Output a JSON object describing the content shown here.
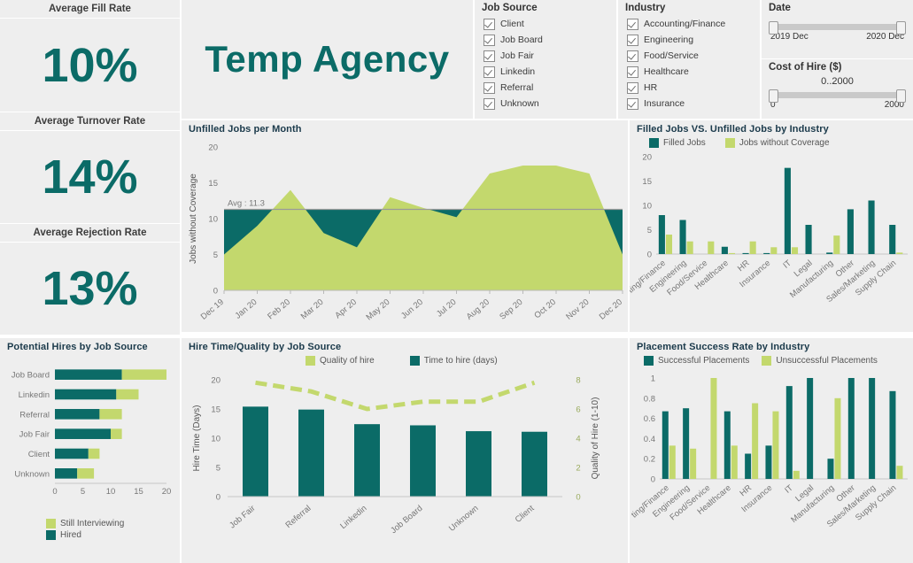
{
  "title": "Temp Agency",
  "kpis": [
    {
      "label": "Average Fill Rate",
      "value": "10%"
    },
    {
      "label": "Average Turnover Rate",
      "value": "14%"
    },
    {
      "label": "Average Rejection Rate",
      "value": "13%"
    }
  ],
  "filters": {
    "job_source": {
      "title": "Job Source",
      "items": [
        "Client",
        "Job Board",
        "Job Fair",
        "Linkedin",
        "Referral",
        "Unknown"
      ],
      "checked": true
    },
    "industry": {
      "title": "Industry",
      "items": [
        "Accounting/Finance",
        "Engineering",
        "Food/Service",
        "Healthcare",
        "HR",
        "Insurance"
      ],
      "checked": true
    },
    "date": {
      "title": "Date",
      "min_label": "2019 Dec",
      "max_label": "2020 Dec"
    },
    "cost": {
      "title": "Cost of Hire ($)",
      "range_label": "0..2000",
      "min_label": "0",
      "max_label": "2000"
    }
  },
  "colors": {
    "teal": "#0b6b67",
    "green": "#c3d86d",
    "panel": "#eeeeee",
    "page": "#ffffff",
    "title": "#0b6b67"
  },
  "chart_data": [
    {
      "id": "unfilled-jobs-per-month",
      "type": "area",
      "title": "Unfilled Jobs per Month",
      "xlabel": "",
      "ylabel": "Jobs without Coverage",
      "ylim": [
        0,
        20
      ],
      "yticks": [
        0,
        5,
        10,
        15,
        20
      ],
      "grid": false,
      "annotation": "Avg : 11.3",
      "average": 11.3,
      "categories": [
        "Dec 19",
        "Jan 20",
        "Feb 20",
        "Mar 20",
        "Apr 20",
        "May 20",
        "Jun 20",
        "Jul 20",
        "Aug 20",
        "Sep 20",
        "Oct 20",
        "Nov 20",
        "Dec 20"
      ],
      "values": [
        5,
        9,
        14,
        8,
        6,
        13,
        11.5,
        10.2,
        16.3,
        17.4,
        17.4,
        16.3,
        5
      ],
      "series": [
        {
          "name": "Jobs without Coverage",
          "values": [
            5,
            9,
            14,
            8,
            6,
            13,
            11.5,
            10.2,
            16.3,
            17.4,
            17.4,
            16.3,
            5
          ],
          "color": "#c3d86d"
        }
      ],
      "background_band_color": "#0b6b67"
    },
    {
      "id": "filled-vs-unfilled-by-industry",
      "type": "bar",
      "title": "Filled Jobs VS. Unfilled Jobs by Industry",
      "xlabel": "",
      "ylabel": "",
      "ylim": [
        0,
        20
      ],
      "yticks": [
        0,
        5,
        10,
        15,
        20
      ],
      "legend": [
        "Filled Jobs",
        "Jobs without Coverage"
      ],
      "legend_position": "top",
      "categories": [
        "Accounting/Finance",
        "Engineering",
        "Food/Service",
        "Healthcare",
        "HR",
        "Insurance",
        "IT",
        "Legal",
        "Manufacturing",
        "Other",
        "Sales/Marketing",
        "Supply Chain"
      ],
      "series": [
        {
          "name": "Filled Jobs",
          "color": "#0b6b67",
          "values": [
            8,
            7,
            0,
            1.5,
            0.2,
            0.2,
            17.7,
            6,
            0.3,
            9.2,
            11,
            6
          ]
        },
        {
          "name": "Jobs without Coverage",
          "color": "#c3d86d",
          "values": [
            4,
            2.6,
            2.6,
            0.2,
            2.6,
            1.4,
            1.4,
            0,
            3.8,
            0,
            0,
            0.3
          ]
        }
      ]
    },
    {
      "id": "potential-hires-by-job-source",
      "type": "bar",
      "orientation": "horizontal",
      "stacked": true,
      "title": "Potential Hires by Job Source",
      "xlim": [
        0,
        20
      ],
      "xticks": [
        0,
        5,
        10,
        15,
        20
      ],
      "legend": [
        "Still Interviewing",
        "Hired"
      ],
      "legend_position": "bottom",
      "categories": [
        "Job Board",
        "Linkedin",
        "Referral",
        "Job Fair",
        "Client",
        "Unknown"
      ],
      "series": [
        {
          "name": "Hired",
          "color": "#0b6b67",
          "values": [
            12,
            11,
            8,
            10,
            6,
            4
          ]
        },
        {
          "name": "Still Interviewing",
          "color": "#c3d86d",
          "values": [
            8,
            4,
            4,
            2,
            2,
            3
          ]
        }
      ]
    },
    {
      "id": "hire-time-quality-by-job-source",
      "type": "bar",
      "title": "Hire Time/Quality by Job Source",
      "ylabel": "Hire Time (Days)",
      "y2label": "Quality of Hire (1-10)",
      "ylim": [
        0,
        20
      ],
      "yticks": [
        0,
        5,
        10,
        15,
        20
      ],
      "y2lim": [
        0,
        8
      ],
      "y2ticks": [
        0,
        2,
        4,
        6,
        8
      ],
      "legend": [
        "Quality of hire",
        "Time to hire (days)"
      ],
      "legend_position": "top",
      "categories": [
        "Job Fair",
        "Referral",
        "Linkedin",
        "Job Board",
        "Unknown",
        "Client"
      ],
      "series": [
        {
          "name": "Time to hire (days)",
          "type": "bar",
          "color": "#0b6b67",
          "values": [
            15.4,
            14.9,
            12.4,
            12.2,
            11.2,
            11.1
          ]
        },
        {
          "name": "Quality of hire",
          "type": "line",
          "style": "dashed",
          "color": "#c3d86d",
          "values": [
            7.8,
            7.2,
            6.0,
            6.5,
            6.5,
            7.8
          ]
        }
      ]
    },
    {
      "id": "placement-success-rate-by-industry",
      "type": "bar",
      "title": "Placement Success Rate by Industry",
      "ylim": [
        0,
        1
      ],
      "yticks": [
        0,
        0.2,
        0.4,
        0.6,
        0.8,
        1
      ],
      "ytick_labels": [
        "0",
        "0.2",
        "0.4",
        "0.6",
        "0.8",
        "1"
      ],
      "legend": [
        "Successful Placements",
        "Unsuccessful Placements"
      ],
      "legend_position": "top",
      "categories": [
        "Accounting/Finance",
        "Engineering",
        "Food/Service",
        "Healthcare",
        "HR",
        "Insurance",
        "IT",
        "Legal",
        "Manufacturing",
        "Other",
        "Sales/Marketing",
        "Supply Chain"
      ],
      "series": [
        {
          "name": "Successful Placements",
          "color": "#0b6b67",
          "values": [
            0.67,
            0.7,
            0,
            0.67,
            0.25,
            0.33,
            0.92,
            1.0,
            0.2,
            1.0,
            1.0,
            0.87
          ]
        },
        {
          "name": "Unsuccessful Placements",
          "color": "#c3d86d",
          "values": [
            0.33,
            0.3,
            1.0,
            0.33,
            0.75,
            0.67,
            0.08,
            0,
            0.8,
            0,
            0,
            0.13
          ]
        }
      ]
    }
  ]
}
